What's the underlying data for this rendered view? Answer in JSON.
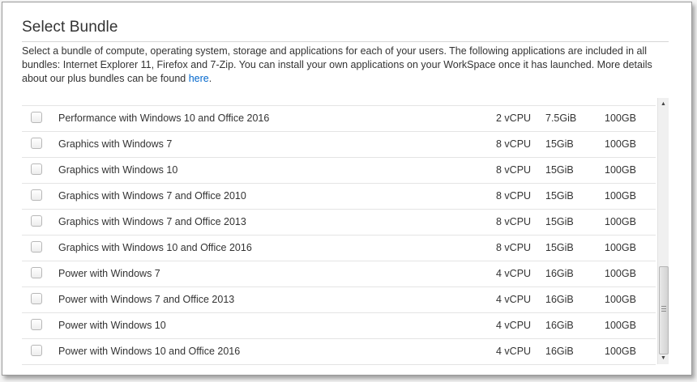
{
  "dialog": {
    "title": "Select Bundle",
    "description": "Select a bundle of compute, operating system, storage and applications for each of your users. The following applications are included in all bundles: Internet Explorer 11, Firefox and 7-Zip. You can install your own applications on your WorkSpace once it has launched. More details about our plus bundles can be found",
    "link_text": "here",
    "trailing_period": "."
  },
  "bundles": [
    {
      "name": "Performance with Windows 10 and Office 2016",
      "vcpu": "2 vCPU",
      "memory": "7.5GiB",
      "storage": "100GB",
      "checked": false
    },
    {
      "name": "Graphics with Windows 7",
      "vcpu": "8 vCPU",
      "memory": "15GiB",
      "storage": "100GB",
      "checked": false
    },
    {
      "name": "Graphics with Windows 10",
      "vcpu": "8 vCPU",
      "memory": "15GiB",
      "storage": "100GB",
      "checked": false
    },
    {
      "name": "Graphics with Windows 7 and Office 2010",
      "vcpu": "8 vCPU",
      "memory": "15GiB",
      "storage": "100GB",
      "checked": false
    },
    {
      "name": "Graphics with Windows 7 and Office 2013",
      "vcpu": "8 vCPU",
      "memory": "15GiB",
      "storage": "100GB",
      "checked": false
    },
    {
      "name": "Graphics with Windows 10 and Office 2016",
      "vcpu": "8 vCPU",
      "memory": "15GiB",
      "storage": "100GB",
      "checked": false
    },
    {
      "name": "Power with Windows 7",
      "vcpu": "4 vCPU",
      "memory": "16GiB",
      "storage": "100GB",
      "checked": false
    },
    {
      "name": "Power with Windows 7 and Office 2013",
      "vcpu": "4 vCPU",
      "memory": "16GiB",
      "storage": "100GB",
      "checked": false
    },
    {
      "name": "Power with Windows 10",
      "vcpu": "4 vCPU",
      "memory": "16GiB",
      "storage": "100GB",
      "checked": false
    },
    {
      "name": "Power with Windows 10 and Office 2016",
      "vcpu": "4 vCPU",
      "memory": "16GiB",
      "storage": "100GB",
      "checked": false
    }
  ],
  "scrollbar": {
    "position": 0.88,
    "up_icon": "triangle-up-icon",
    "down_icon": "triangle-down-icon"
  },
  "colors": {
    "link": "#0066cc",
    "text": "#333333",
    "row_border": "#e4e4e4"
  }
}
